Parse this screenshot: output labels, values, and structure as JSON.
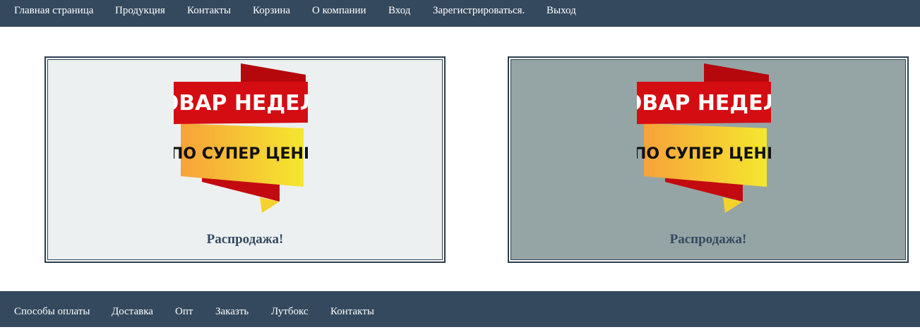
{
  "topnav": {
    "items": [
      {
        "label": "Главная страница"
      },
      {
        "label": "Продукция"
      },
      {
        "label": "Контакты"
      },
      {
        "label": "Корзина"
      },
      {
        "label": "О компании"
      },
      {
        "label": "Вход"
      },
      {
        "label": "Зарегистрироваться."
      },
      {
        "label": "Выход"
      }
    ]
  },
  "cards": [
    {
      "banner_line1": "ТОВАР НЕДЕЛИ",
      "banner_line2": "ПО СУПЕР ЦЕНЕ",
      "caption": "Распродажа!"
    },
    {
      "banner_line1": "ТОВАР НЕДЕЛИ",
      "banner_line2": "ПО СУПЕР ЦЕНЕ",
      "caption": "Распродажа!"
    }
  ],
  "footer": {
    "items": [
      {
        "label": "Способы оплаты"
      },
      {
        "label": "Доставка"
      },
      {
        "label": "Опт"
      },
      {
        "label": "Заказть"
      },
      {
        "label": "Лутбокс"
      },
      {
        "label": "Контакты"
      }
    ]
  },
  "colors": {
    "nav_background": "#34495e",
    "card_left_background": "#ecf0f1",
    "card_right_background": "#95a5a6",
    "banner_red": "#d40d12",
    "banner_yellow": "#f5e72e"
  }
}
